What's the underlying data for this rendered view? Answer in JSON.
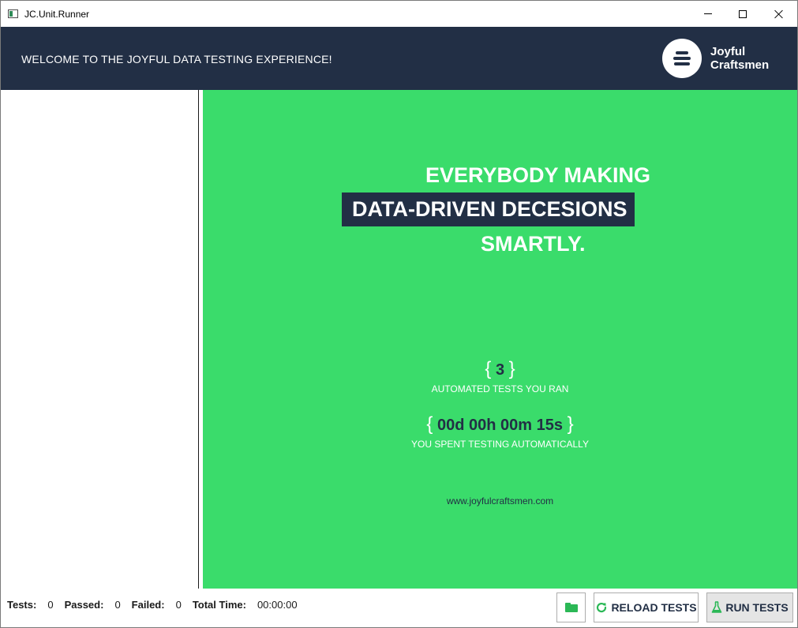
{
  "window": {
    "title": "JC.Unit.Runner"
  },
  "header": {
    "welcome_text": "WELCOME TO THE JOYFUL DATA TESTING EXPERIENCE!",
    "logo_line1": "Joyful",
    "logo_line2": "Craftsmen"
  },
  "main": {
    "tagline_line1": "EVERYBODY MAKING",
    "tagline_line2": "DATA-DRIVEN DECESIONS",
    "tagline_line3": "SMARTLY.",
    "tests_count": "3",
    "tests_label": "AUTOMATED TESTS YOU RAN",
    "time_value": "00d 00h 00m 15s",
    "time_label": "YOU SPENT TESTING AUTOMATICALLY",
    "website": "www.joyfulcraftsmen.com",
    "brace_open": "{",
    "brace_close": "}"
  },
  "statusbar": {
    "tests_label": "Tests:",
    "tests_value": "0",
    "passed_label": "Passed:",
    "passed_value": "0",
    "failed_label": "Failed:",
    "failed_value": "0",
    "total_time_label": "Total Time:",
    "total_time_value": "00:00:00"
  },
  "buttons": {
    "reload_label": "RELOAD TESTS",
    "run_label": "RUN TESTS"
  },
  "icons": {
    "folder": "folder-open-icon",
    "reload": "refresh-icon",
    "run": "flask-icon",
    "logo": "stack-icon"
  },
  "colors": {
    "header_bg": "#222f45",
    "main_bg": "#3adc6b",
    "accent_green": "#2bb856"
  }
}
